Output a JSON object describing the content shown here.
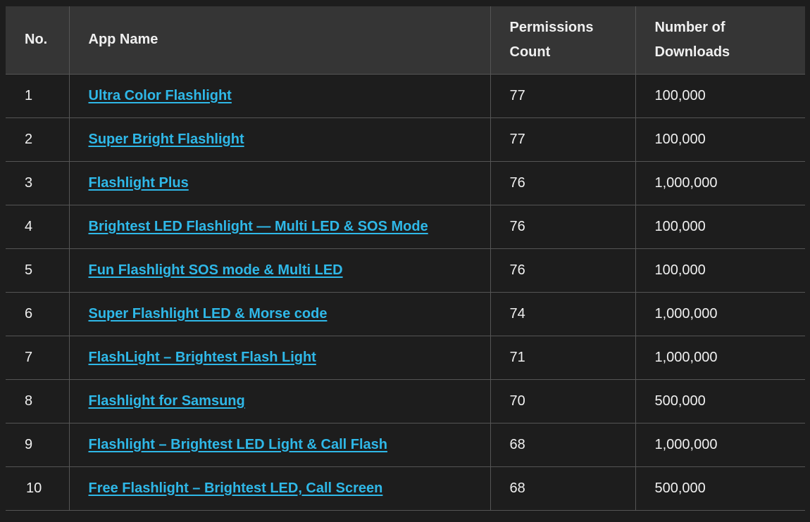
{
  "table": {
    "headers": {
      "no": "No.",
      "app_name": "App Name",
      "permissions_count": "Permissions Count",
      "downloads": "Number of Downloads"
    },
    "rows": [
      {
        "no": "1",
        "app_name": "Ultra Color Flashlight",
        "permissions": "77",
        "downloads": "100,000"
      },
      {
        "no": "2",
        "app_name": "Super Bright Flashlight",
        "permissions": "77",
        "downloads": "100,000"
      },
      {
        "no": "3",
        "app_name": "Flashlight Plus",
        "permissions": "76",
        "downloads": "1,000,000"
      },
      {
        "no": "4",
        "app_name": "Brightest LED Flashlight — Multi LED & SOS Mode",
        "permissions": "76",
        "downloads": "100,000"
      },
      {
        "no": "5",
        "app_name": "Fun Flashlight SOS mode & Multi LED",
        "permissions": "76",
        "downloads": "100,000"
      },
      {
        "no": "6",
        "app_name": "Super Flashlight LED & Morse code",
        "permissions": "74",
        "downloads": "1,000,000"
      },
      {
        "no": "7",
        "app_name": "FlashLight – Brightest Flash Light",
        "permissions": "71",
        "downloads": "1,000,000"
      },
      {
        "no": "8",
        "app_name": "Flashlight for Samsung",
        "permissions": "70",
        "downloads": "500,000"
      },
      {
        "no": "9",
        "app_name": "Flashlight – Brightest LED Light & Call Flash",
        "permissions": "68",
        "downloads": "1,000,000"
      },
      {
        "no": "10",
        "app_name": "Free Flashlight – Brightest LED, Call Screen",
        "permissions": "68",
        "downloads": "500,000"
      }
    ]
  },
  "colors": {
    "background": "#1d1d1d",
    "header_background": "#353535",
    "border": "#555555",
    "text": "#f0f0f0",
    "link": "#2fb8e8"
  }
}
